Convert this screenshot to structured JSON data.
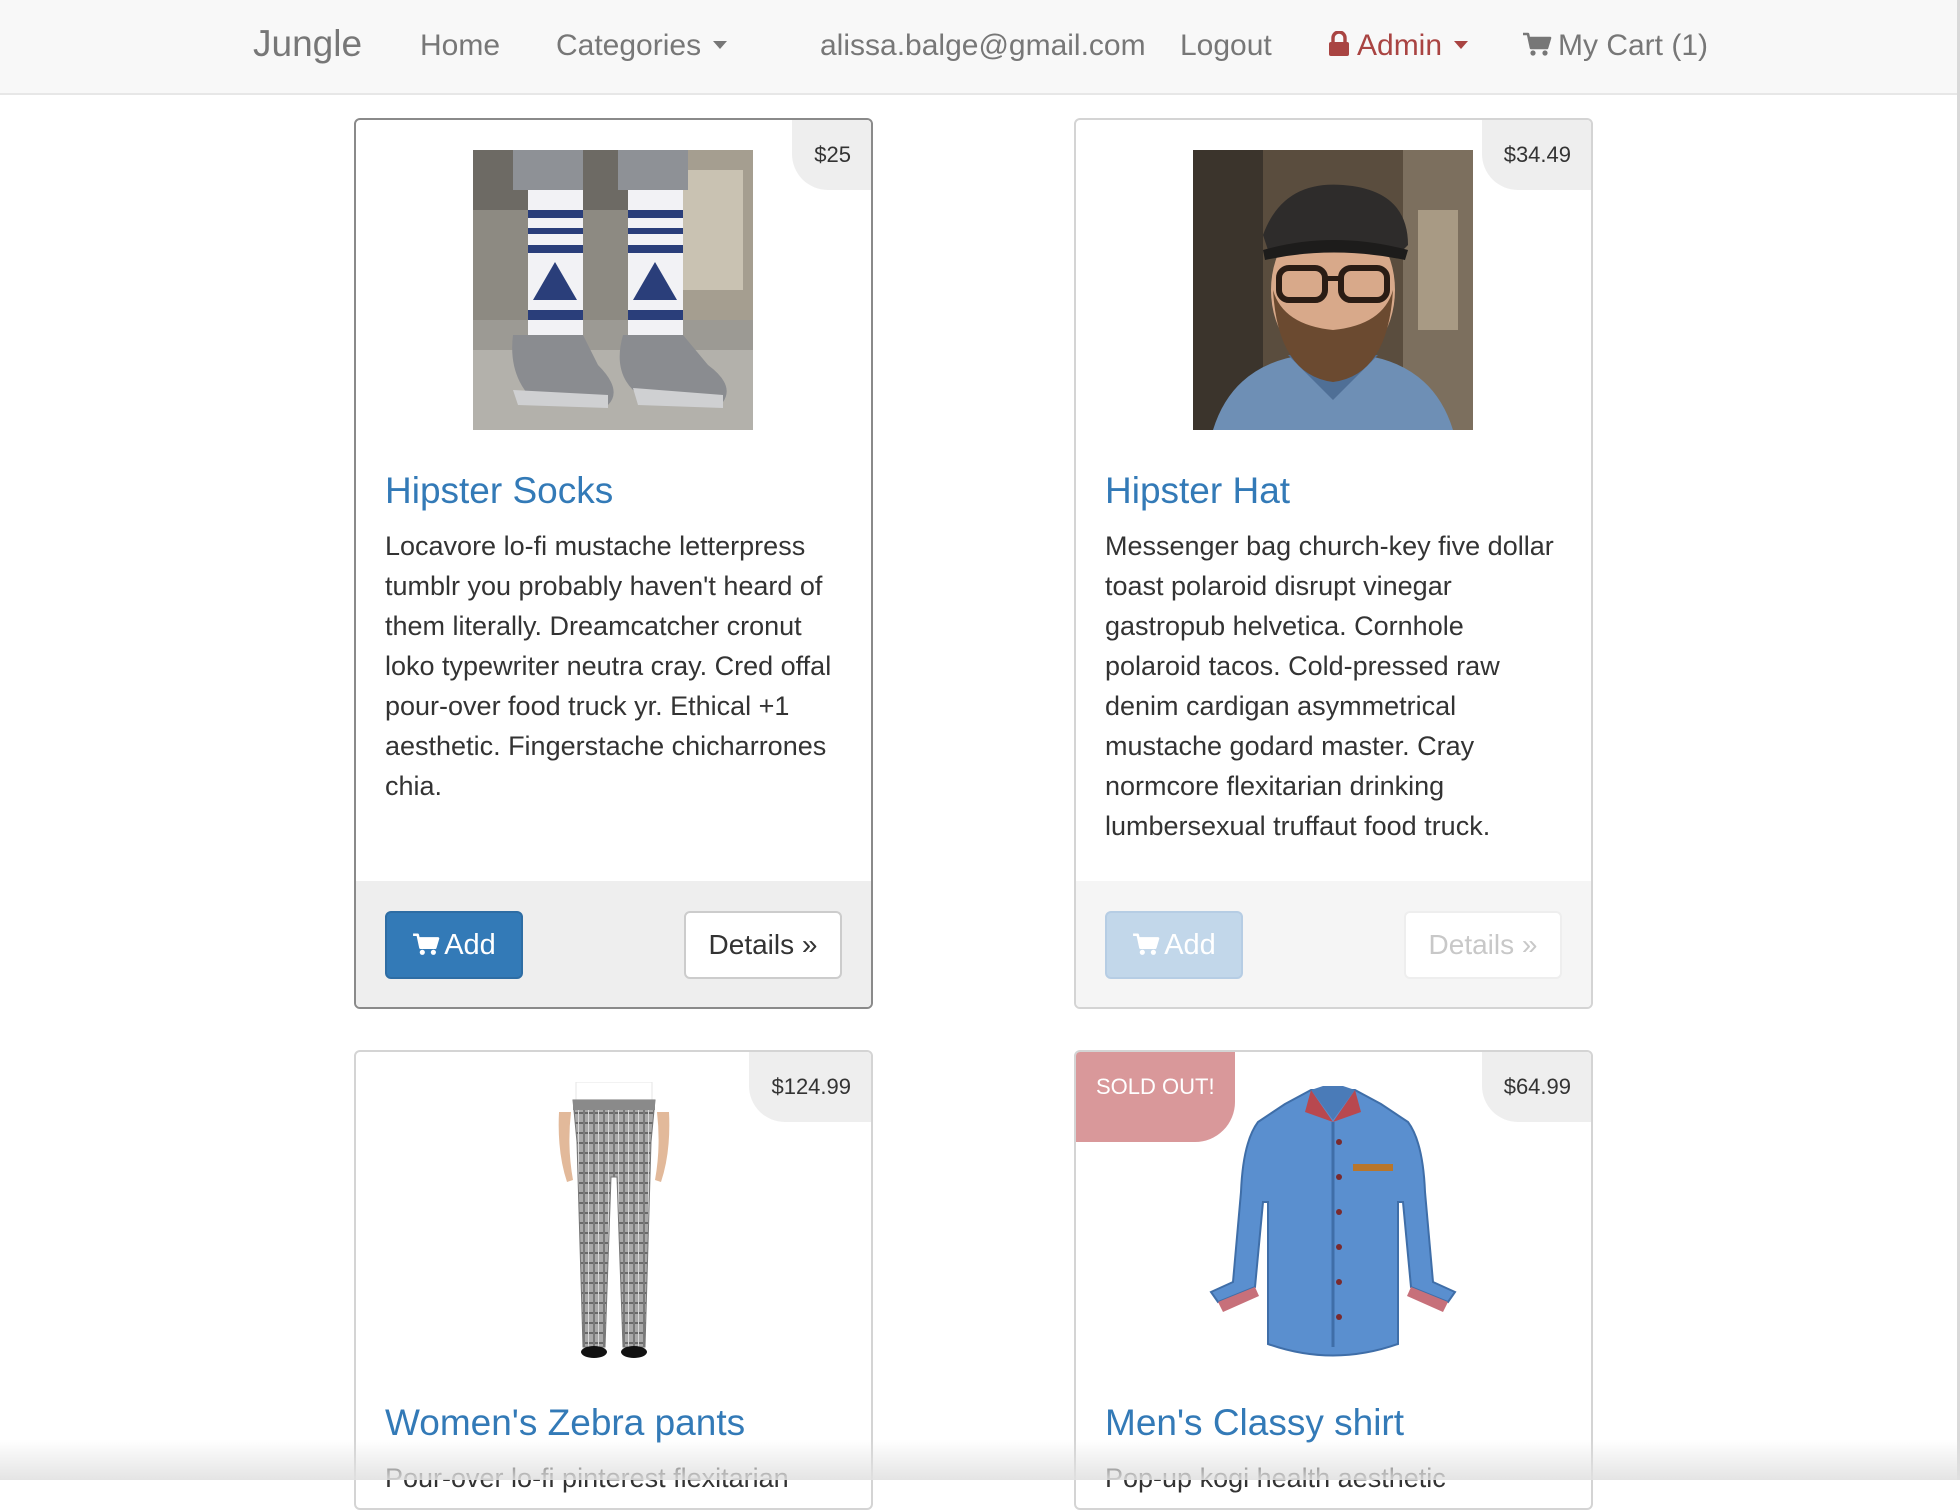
{
  "navbar": {
    "brand": "Jungle",
    "home": "Home",
    "categories": "Categories",
    "email": "alissa.balge@gmail.com",
    "logout": "Logout",
    "admin": "Admin",
    "cart": "My Cart (1)",
    "icons": {
      "admin": "lock-icon",
      "cart": "shopping-cart-icon",
      "dropdown": "caret-down-icon"
    },
    "admin_color": "#a94442"
  },
  "products": [
    {
      "name": "Hipster Socks",
      "price": "$25",
      "description": "Locavore lo-fi mustache letterpress tumblr you probably haven't heard of them literally. Dreamcatcher cronut loko typewriter neutra cray. Cred offal pour-over food truck yr. Ethical +1 aesthetic. Fingerstache chicharrones chia.",
      "add_label": "Add",
      "details_label": "Details »",
      "image": "patterned-socks-and-grey-shoes-photo"
    },
    {
      "name": "Hipster Hat",
      "price": "$34.49",
      "description": "Messenger bag church-key five dollar toast polaroid disrupt vinegar gastropub helvetica. Cornhole polaroid tacos. Cold-pressed raw denim cardigan asymmetrical mustache godard master. Cray normcore flexitarian drinking lumbersexual truffaut food truck.",
      "add_label": "Add",
      "details_label": "Details »",
      "image": "bearded-man-in-flat-cap-photo"
    },
    {
      "name": "Women's Zebra pants",
      "price": "$124.99",
      "description": "Pour-over lo-fi pinterest flexitarian",
      "image": "plaid-trousers-photo"
    },
    {
      "name": "Men's Classy shirt",
      "price": "$64.99",
      "sold_out": "SOLD OUT!",
      "description": "Pop-up kogi health aesthetic",
      "image": "denim-shirt-photo"
    }
  ],
  "colors": {
    "link": "#337ab7",
    "primary_button": "#337ab7",
    "sold_out_badge": "#d9989a",
    "price_badge": "#eeeeee"
  }
}
